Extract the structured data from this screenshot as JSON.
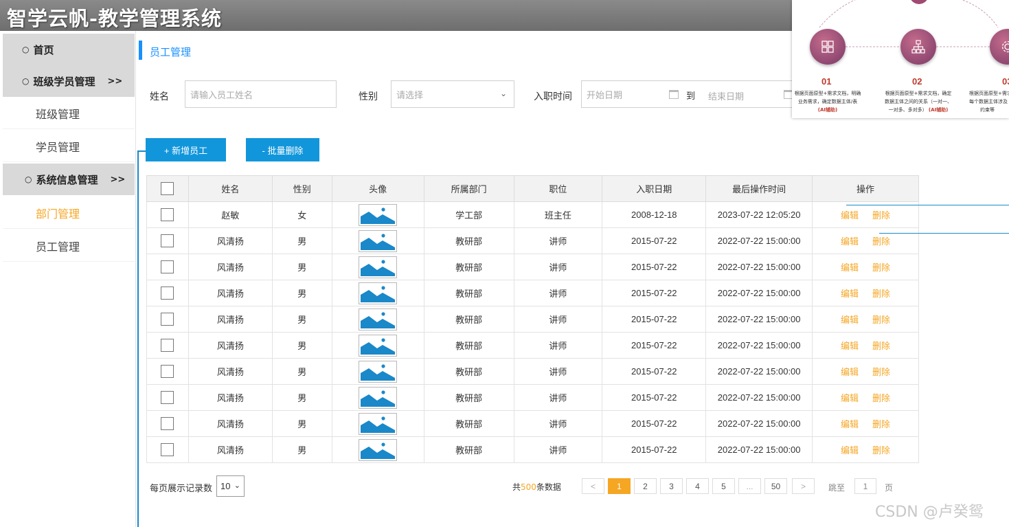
{
  "header": {
    "title": "智学云帆-教学管理系统"
  },
  "sidebar": {
    "home": "首页",
    "class_group": "班级学员管理",
    "class_group_arrow": ">>",
    "class_items": [
      "班级管理",
      "学员管理"
    ],
    "system_group": "系统信息管理",
    "system_group_arrow": ">>",
    "system_items": [
      "部门管理",
      "员工管理"
    ]
  },
  "main": {
    "page_title": "员工管理",
    "filters": {
      "name_label": "姓名",
      "name_placeholder": "请输入员工姓名",
      "gender_label": "性别",
      "gender_placeholder": "请选择",
      "date_label": "入职时间",
      "start_placeholder": "开始日期",
      "to_label": "到",
      "end_placeholder": "结束日期"
    },
    "buttons": {
      "add": "+ 新增员工",
      "batch_delete": "- 批量删除"
    },
    "table": {
      "headers": [
        "姓名",
        "性别",
        "头像",
        "所属部门",
        "职位",
        "入职日期",
        "最后操作时间",
        "操作"
      ],
      "rows": [
        {
          "name": "赵敏",
          "gender": "女",
          "dept": "学工部",
          "position": "班主任",
          "hire": "2008-12-18",
          "updated": "2023-07-22 12:05:20"
        },
        {
          "name": "风清扬",
          "gender": "男",
          "dept": "教研部",
          "position": "讲师",
          "hire": "2015-07-22",
          "updated": "2022-07-22 15:00:00"
        },
        {
          "name": "风清扬",
          "gender": "男",
          "dept": "教研部",
          "position": "讲师",
          "hire": "2015-07-22",
          "updated": "2022-07-22 15:00:00"
        },
        {
          "name": "风清扬",
          "gender": "男",
          "dept": "教研部",
          "position": "讲师",
          "hire": "2015-07-22",
          "updated": "2022-07-22 15:00:00"
        },
        {
          "name": "风清扬",
          "gender": "男",
          "dept": "教研部",
          "position": "讲师",
          "hire": "2015-07-22",
          "updated": "2022-07-22 15:00:00"
        },
        {
          "name": "风清扬",
          "gender": "男",
          "dept": "教研部",
          "position": "讲师",
          "hire": "2015-07-22",
          "updated": "2022-07-22 15:00:00"
        },
        {
          "name": "风清扬",
          "gender": "男",
          "dept": "教研部",
          "position": "讲师",
          "hire": "2015-07-22",
          "updated": "2022-07-22 15:00:00"
        },
        {
          "name": "风清扬",
          "gender": "男",
          "dept": "教研部",
          "position": "讲师",
          "hire": "2015-07-22",
          "updated": "2022-07-22 15:00:00"
        },
        {
          "name": "风清扬",
          "gender": "男",
          "dept": "教研部",
          "position": "讲师",
          "hire": "2015-07-22",
          "updated": "2022-07-22 15:00:00"
        },
        {
          "name": "风清扬",
          "gender": "男",
          "dept": "教研部",
          "position": "讲师",
          "hire": "2015-07-22",
          "updated": "2022-07-22 15:00:00"
        }
      ],
      "edit_label": "编辑",
      "delete_label": "删除"
    },
    "pagination": {
      "per_page_label": "每页展示记录数",
      "per_page_value": "10",
      "total_prefix": "共",
      "total_count": "500",
      "total_suffix": "条数据",
      "prev": "<",
      "pages": [
        "1",
        "2",
        "3",
        "4",
        "5",
        "...",
        "50"
      ],
      "current_page": "1",
      "next": ">",
      "jump_label": "跳至",
      "jump_value": "1",
      "page_unit": "页"
    }
  },
  "overlay": {
    "steps": [
      {
        "num": "01",
        "line1": "根据页面原型+需求文档，明确",
        "line2": "业务需求，确定数据主体/表",
        "ai": "(AI辅助)"
      },
      {
        "num": "02",
        "line1": "根据页面原型+需求文档，确定",
        "line2": "数据主体之间的关系（一对一、",
        "line3": "一对多、多对多）",
        "ai": "(AI辅助)"
      },
      {
        "num": "03",
        "line1": "根据页面原型+需求",
        "line2": "每个数据主体涉及",
        "line3": "约束等"
      }
    ]
  },
  "watermark": "CSDN @卢癸鸳",
  "colors": {
    "accent": "#1890ff",
    "button": "#1296db",
    "orange": "#f5a623",
    "header": "#7a7a7a"
  }
}
